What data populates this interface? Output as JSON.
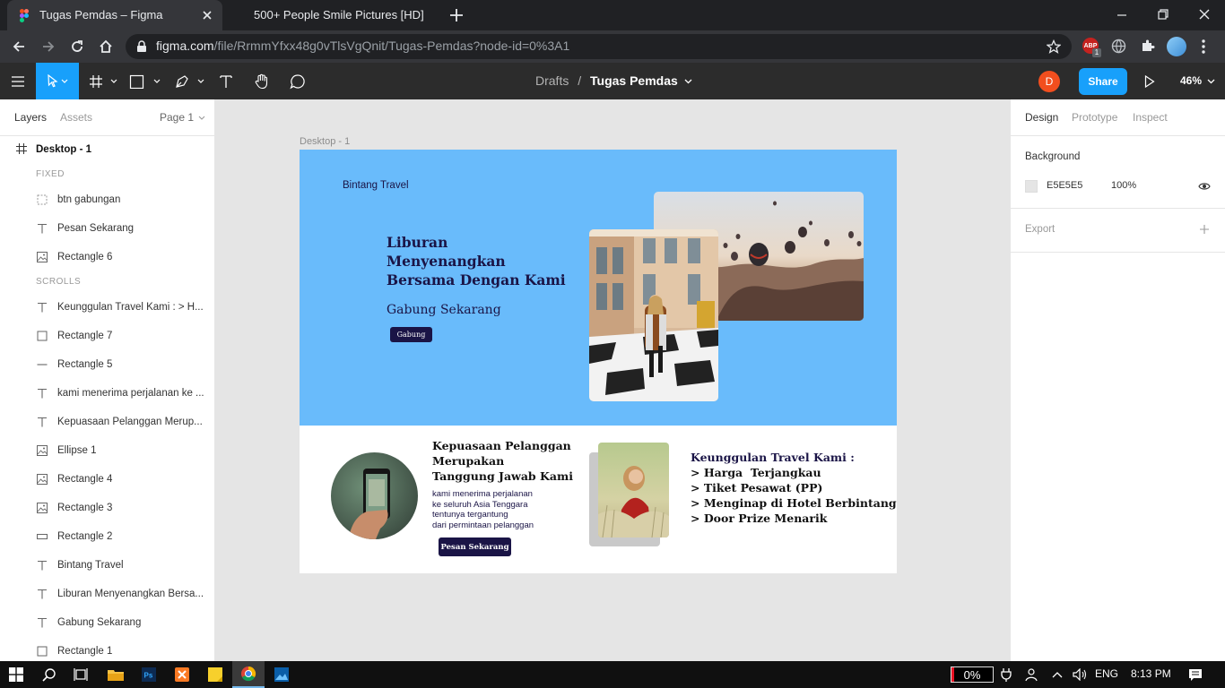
{
  "browser": {
    "tabs": [
      {
        "title": "Tugas Pemdas – Figma",
        "active": true
      },
      {
        "title": "500+ People Smile Pictures [HD]",
        "active": false
      }
    ],
    "url_host": "figma.com",
    "url_path": "/file/RrmmYfxx48g0vTlsVgQnit/Tugas-Pemdas?node-id=0%3A1",
    "extension_badge": "ABP",
    "extension_count": "1"
  },
  "figma": {
    "breadcrumb_parent": "Drafts",
    "breadcrumb_sep": "/",
    "file_name": "Tugas Pemdas",
    "avatar_initial": "D",
    "share_label": "Share",
    "zoom": "46%"
  },
  "left_panel": {
    "tabs": [
      "Layers",
      "Assets"
    ],
    "page": "Page 1",
    "frame_layer": "Desktop - 1",
    "section_fixed": "FIXED",
    "section_scrolls": "SCROLLS",
    "fixed_layers": [
      {
        "label": "btn gabungan",
        "icon": "component-dashed-icon"
      },
      {
        "label": "Pesan Sekarang",
        "icon": "text-icon"
      },
      {
        "label": "Rectangle 6",
        "icon": "image-icon"
      }
    ],
    "scroll_layers": [
      {
        "label": "Keunggulan Travel Kami : > H...",
        "icon": "text-icon"
      },
      {
        "label": "Rectangle 7",
        "icon": "rectangle-icon"
      },
      {
        "label": "Rectangle 5",
        "icon": "line-rect-icon"
      },
      {
        "label": "kami menerima perjalanan ke ...",
        "icon": "text-icon"
      },
      {
        "label": "Kepuasaan Pelanggan Merup...",
        "icon": "text-icon"
      },
      {
        "label": "Ellipse 1",
        "icon": "image-icon"
      },
      {
        "label": "Rectangle 4",
        "icon": "image-icon"
      },
      {
        "label": "Rectangle 3",
        "icon": "image-icon"
      },
      {
        "label": "Rectangle 2",
        "icon": "flat-rect-icon"
      },
      {
        "label": "Bintang Travel",
        "icon": "text-icon"
      },
      {
        "label": "Liburan Menyenangkan Bersa...",
        "icon": "text-icon"
      },
      {
        "label": "Gabung Sekarang",
        "icon": "text-icon"
      },
      {
        "label": "Rectangle 1",
        "icon": "rectangle-icon"
      }
    ]
  },
  "right_panel": {
    "tabs": [
      "Design",
      "Prototype",
      "Inspect"
    ],
    "background_label": "Background",
    "bg_hex": "E5E5E5",
    "bg_opacity": "100%",
    "export_label": "Export"
  },
  "canvas": {
    "frame_label": "Desktop - 1",
    "brand": "Bintang Travel",
    "headline_1": "Liburan",
    "headline_2": "Menyenangkan",
    "headline_3": "Bersama Dengan Kami",
    "subheadline": "Gabung Sekarang",
    "join_button": "Gabung",
    "satisfaction_title_1": "Kepuasaan Pelanggan",
    "satisfaction_title_2": "Merupakan",
    "satisfaction_title_3": "Tanggung Jawab Kami",
    "body_1": "kami menerima perjalanan",
    "body_2": "ke seluruh Asia Tenggara",
    "body_3": "tentunya tergantung",
    "body_4": "dari permintaan pelanggan",
    "order_button": "Pesan Sekarang",
    "adv_title": "Keunggulan Travel Kami :",
    "adv_1": "> Harga  Terjangkau",
    "adv_2": "> Tiket Pesawat (PP)",
    "adv_3": "> Menginap di Hotel Berbintang",
    "adv_4": "> Door Prize Menarik"
  },
  "taskbar": {
    "battery": "0%",
    "language": "ENG",
    "time": "8:13 PM"
  },
  "colors": {
    "hero_blue": "#69bbfb",
    "figma_blue": "#18a0fb",
    "navy_button": "#1a1446",
    "avatar_orange": "#f24e1e"
  }
}
